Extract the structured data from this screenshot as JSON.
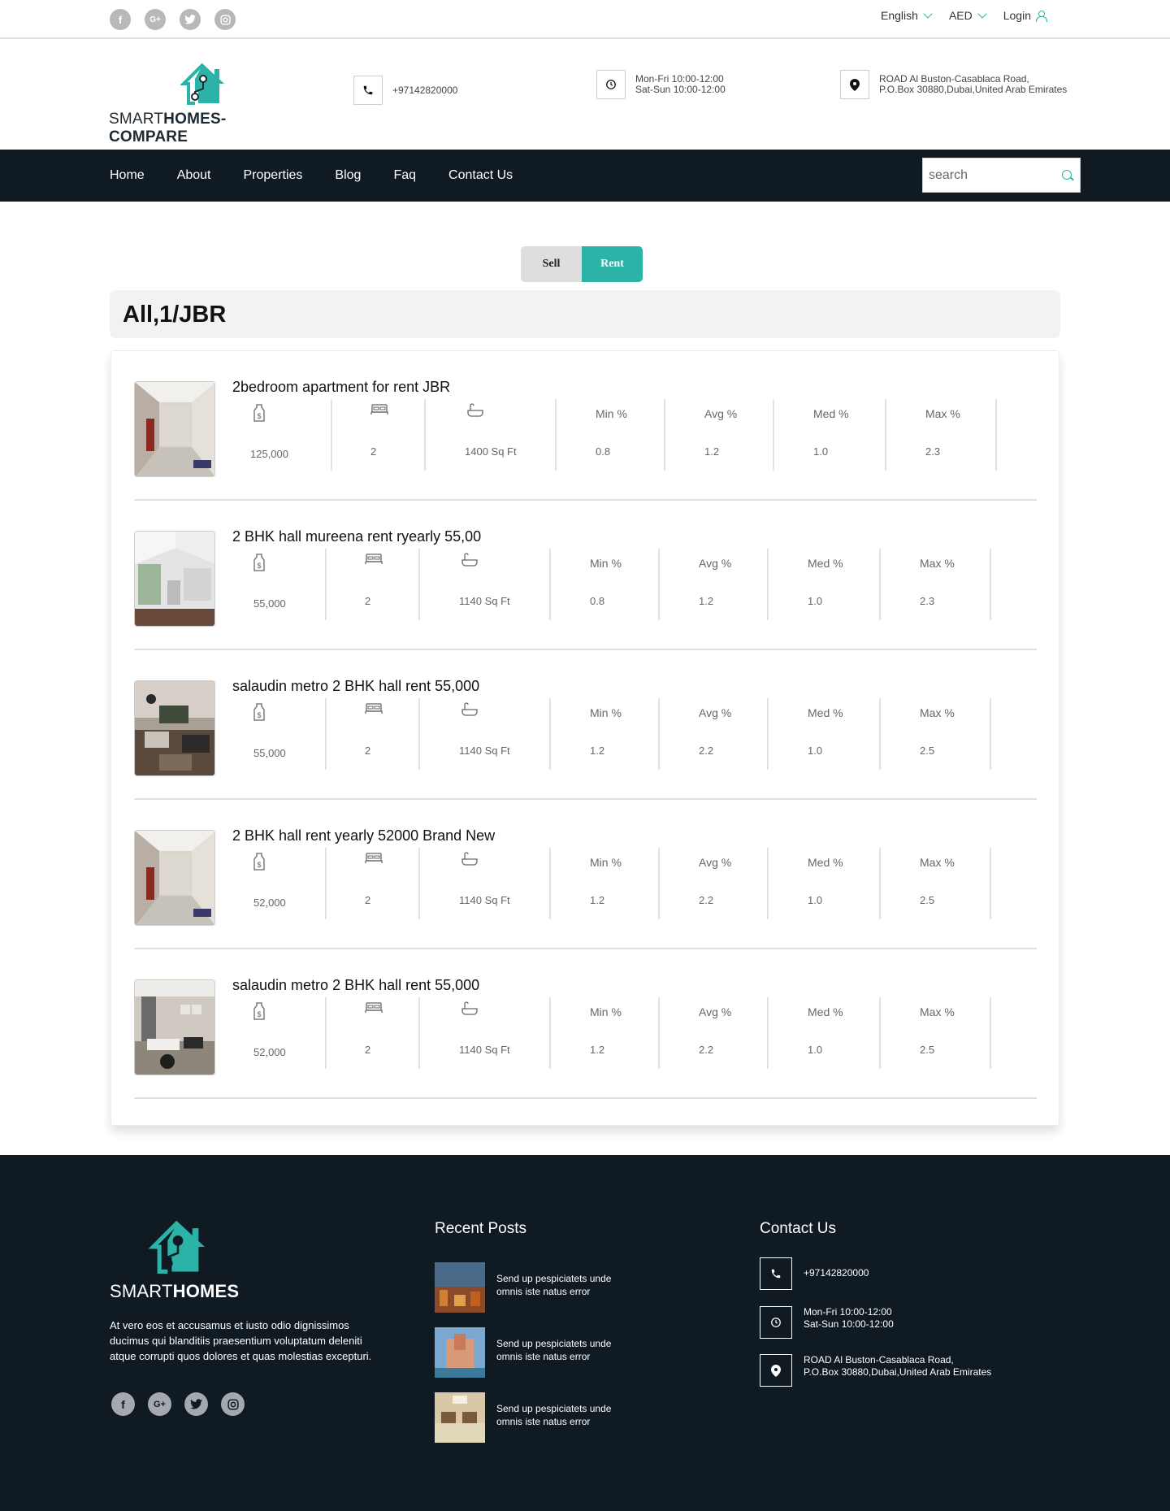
{
  "topbar": {
    "social_icons": [
      "facebook-icon",
      "google-plus-icon",
      "twitter-icon",
      "instagram-icon"
    ],
    "language": "English",
    "currency": "AED",
    "login": "Login"
  },
  "header": {
    "logo_part1": "SMART",
    "logo_part2": "HOMES-COMPARE",
    "phone": "+97142820000",
    "hours_line1": "Mon-Fri 10:00-12:00",
    "hours_line2": "Sat-Sun 10:00-12:00",
    "address_line1": "ROAD Al Buston-Casablaca Road,",
    "address_line2": "P.O.Box 30880,Dubai,United Arab Emirates"
  },
  "nav": {
    "items": [
      "Home",
      "About",
      "Properties",
      "Blog",
      "Faq",
      "Contact Us"
    ],
    "search_placeholder": "search"
  },
  "toggle": {
    "sell": "Sell",
    "rent": "Rent",
    "active": "Rent"
  },
  "page_title": "All,1/JBR",
  "stat_labels": {
    "min": "Min %",
    "avg": "Avg %",
    "med": "Med %",
    "max": "Max %"
  },
  "listings": [
    {
      "title": "2bedroom apartment for rent JBR",
      "price": "125,000",
      "beds": "2",
      "area": "1400 Sq Ft",
      "min": "0.8",
      "avg": "1.2",
      "med": "1.0",
      "max": "2.3"
    },
    {
      "title": "2 BHK hall mureena rent ryearly 55,00",
      "price": "55,000",
      "beds": "2",
      "area": "1140 Sq Ft",
      "min": "0.8",
      "avg": "1.2",
      "med": "1.0",
      "max": "2.3"
    },
    {
      "title": "salaudin metro 2 BHK hall rent 55,000",
      "price": "55,000",
      "beds": "2",
      "area": "1140 Sq Ft",
      "min": "1.2",
      "avg": "2.2",
      "med": "1.0",
      "max": "2.5"
    },
    {
      "title": "2 BHK hall rent yearly 52000 Brand New",
      "price": "52,000",
      "beds": "2",
      "area": "1140 Sq Ft",
      "min": "1.2",
      "avg": "2.2",
      "med": "1.0",
      "max": "2.5"
    },
    {
      "title": "salaudin metro 2 BHK hall rent 55,000",
      "price": "52,000",
      "beds": "2",
      "area": "1140 Sq Ft",
      "min": "1.2",
      "avg": "2.2",
      "med": "1.0",
      "max": "2.5"
    }
  ],
  "footer": {
    "logo_part1": "SMART",
    "logo_part2": "HOMES",
    "description": "At vero eos et accusamus et iusto odio dignissimos ducimus qui blanditiis praesentium voluptatum deleniti atque corrupti quos dolores et quas molestias excepturi.",
    "recent_posts_title": "Recent Posts",
    "posts": [
      {
        "line1": "Send up pespiciatets unde",
        "line2": "omnis iste natus error"
      },
      {
        "line1": "Send up pespiciatets unde",
        "line2": "omnis iste natus error"
      },
      {
        "line1": "Send up pespiciatets unde",
        "line2": "omnis iste natus error"
      }
    ],
    "contact_title": "Contact Us",
    "phone": "+97142820000",
    "hours_line1": "Mon-Fri 10:00-12:00",
    "hours_line2": "Sat-Sun 10:00-12:00",
    "address_line1": "ROAD Al Buston-Casablaca Road,",
    "address_line2": "P.O.Box 30880,Dubai,United Arab Emirates"
  },
  "colors": {
    "accent": "#2ab3a6",
    "dark": "#0f1a22"
  }
}
